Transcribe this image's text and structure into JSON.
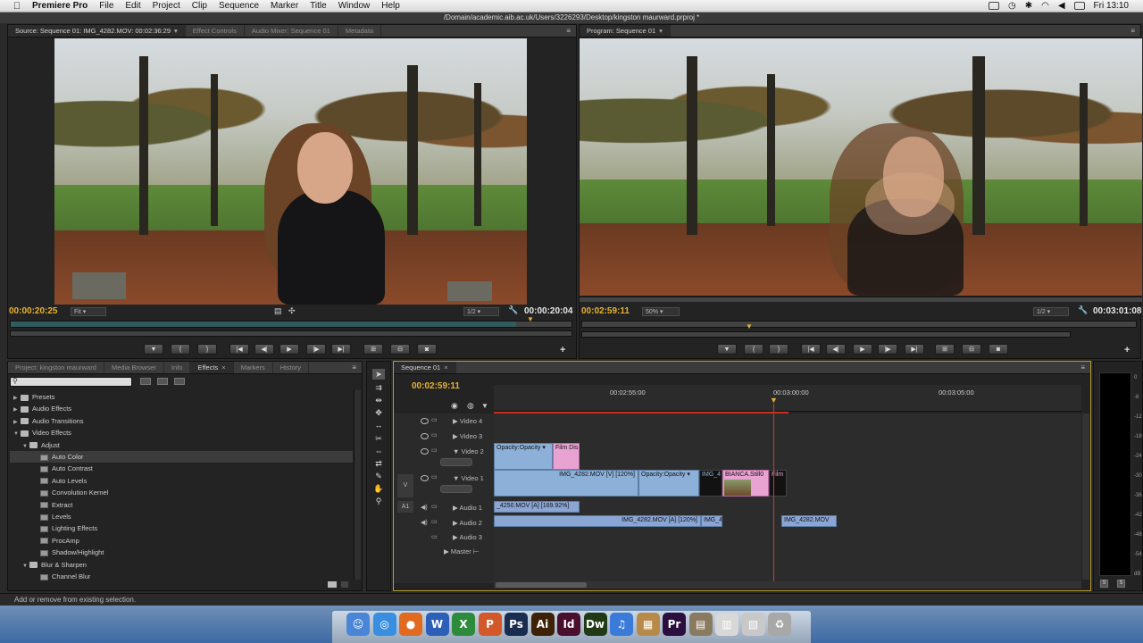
{
  "menubar": {
    "app": "Premiere Pro",
    "items": [
      "File",
      "Edit",
      "Project",
      "Clip",
      "Sequence",
      "Marker",
      "Title",
      "Window",
      "Help"
    ],
    "clock": "Fri 13:10"
  },
  "window_title": "/Domain/academic.aib.ac.uk/Users/3226293/Desktop/kingston maurward.prproj *",
  "source_monitor": {
    "tabs": [
      "Source: Sequence 01: IMG_4282.MOV: 00:02:36:29",
      "Effect Controls",
      "Audio Mixer: Sequence 01",
      "Metadata"
    ],
    "timecode_left": "00:00:20:25",
    "zoom": "Fit",
    "resolution": "1/2",
    "timecode_right": "00:00:20:04",
    "buttons": [
      "marker",
      "in-point",
      "out-point",
      "goto-in",
      "step-back",
      "play",
      "step-forward",
      "goto-out",
      "insert",
      "overwrite",
      "export-frame"
    ]
  },
  "program_monitor": {
    "tab": "Program: Sequence 01",
    "timecode_left": "00:02:59:11",
    "zoom": "50%",
    "resolution": "1/2",
    "timecode_right": "00:03:01:08"
  },
  "project_panel": {
    "tabs": [
      "Project: kingston maurward",
      "Media Browser",
      "Info",
      "Effects",
      "Markers",
      "History"
    ],
    "items": [
      {
        "label": "Presets",
        "level": 0,
        "type": "folder",
        "open": false
      },
      {
        "label": "Audio Effects",
        "level": 0,
        "type": "folder",
        "open": false
      },
      {
        "label": "Audio Transitions",
        "level": 0,
        "type": "folder",
        "open": false
      },
      {
        "label": "Video Effects",
        "level": 0,
        "type": "folder",
        "open": true
      },
      {
        "label": "Adjust",
        "level": 1,
        "type": "folder",
        "open": true
      },
      {
        "label": "Auto Color",
        "level": 2,
        "type": "effect",
        "selected": true
      },
      {
        "label": "Auto Contrast",
        "level": 2,
        "type": "effect"
      },
      {
        "label": "Auto Levels",
        "level": 2,
        "type": "effect"
      },
      {
        "label": "Convolution Kernel",
        "level": 2,
        "type": "effect"
      },
      {
        "label": "Extract",
        "level": 2,
        "type": "effect"
      },
      {
        "label": "Levels",
        "level": 2,
        "type": "effect"
      },
      {
        "label": "Lighting Effects",
        "level": 2,
        "type": "effect"
      },
      {
        "label": "ProcAmp",
        "level": 2,
        "type": "effect"
      },
      {
        "label": "Shadow/Highlight",
        "level": 2,
        "type": "effect"
      },
      {
        "label": "Blur & Sharpen",
        "level": 1,
        "type": "folder",
        "open": true
      },
      {
        "label": "Channel Blur",
        "level": 2,
        "type": "effect"
      }
    ]
  },
  "timeline": {
    "tab": "Sequence 01",
    "timecode": "00:02:59:11",
    "ruler": [
      "00:02:55:00",
      "00:03:00:00",
      "00:03:05:00"
    ],
    "video_tracks": [
      "Video 4",
      "Video 3",
      "Video 2",
      "Video 1"
    ],
    "audio_tracks": [
      "Audio 1",
      "Audio 2",
      "Audio 3",
      "Master"
    ],
    "src_v": "V",
    "src_a": "A1",
    "clips": {
      "v2_opacity": "Opacity:Opacity",
      "v2_film": "Film Dis",
      "v1_main": "IMG_4282.MOV [V] [120%]",
      "v1_opacity": "Opacity:Opacity",
      "v1_img": "IMG_4",
      "v1_bianca": "BIANCA.Still0",
      "v1_film": "Film",
      "a1_clip": "_4250.MOV [A] [169.92%]",
      "a2_main": "IMG_4282.MOV [A] [120%]",
      "a2_img": "IMG_4",
      "a2_last": "IMG_4282.MOV"
    }
  },
  "meter_labels": [
    "0",
    "-6",
    "-12",
    "-18",
    "-24",
    "-30",
    "-36",
    "-42",
    "-48",
    "-54",
    "dB"
  ],
  "status": "Add or remove from existing selection.",
  "dock_icons": [
    {
      "name": "finder",
      "glyph": "☺",
      "color": "#4a86d8"
    },
    {
      "name": "safari",
      "glyph": "◎",
      "color": "#3a8ee0"
    },
    {
      "name": "firefox",
      "glyph": "●",
      "color": "#e06a20"
    },
    {
      "name": "word",
      "glyph": "W",
      "color": "#2b5fb8"
    },
    {
      "name": "excel",
      "glyph": "X",
      "color": "#2e8b3c"
    },
    {
      "name": "powerpoint",
      "glyph": "P",
      "color": "#d2582a"
    },
    {
      "name": "photoshop",
      "glyph": "Ps",
      "color": "#1a2c4f"
    },
    {
      "name": "illustrator",
      "glyph": "Ai",
      "color": "#3d2208"
    },
    {
      "name": "indesign",
      "glyph": "Id",
      "color": "#4a0f2e"
    },
    {
      "name": "dreamweaver",
      "glyph": "Dw",
      "color": "#1f3a14"
    },
    {
      "name": "itunes",
      "glyph": "♫",
      "color": "#3a7ad8"
    },
    {
      "name": "preview",
      "glyph": "▦",
      "color": "#b88a4a"
    },
    {
      "name": "premiere",
      "glyph": "Pr",
      "color": "#2a0f3f"
    },
    {
      "name": "document",
      "glyph": "▤",
      "color": "#8a7a60"
    },
    {
      "name": "files",
      "glyph": "▥",
      "color": "#d8d8d8"
    },
    {
      "name": "screenshots",
      "glyph": "▧",
      "color": "#c8c8c8"
    },
    {
      "name": "trash",
      "glyph": "♻",
      "color": "#a8a8a8"
    }
  ]
}
